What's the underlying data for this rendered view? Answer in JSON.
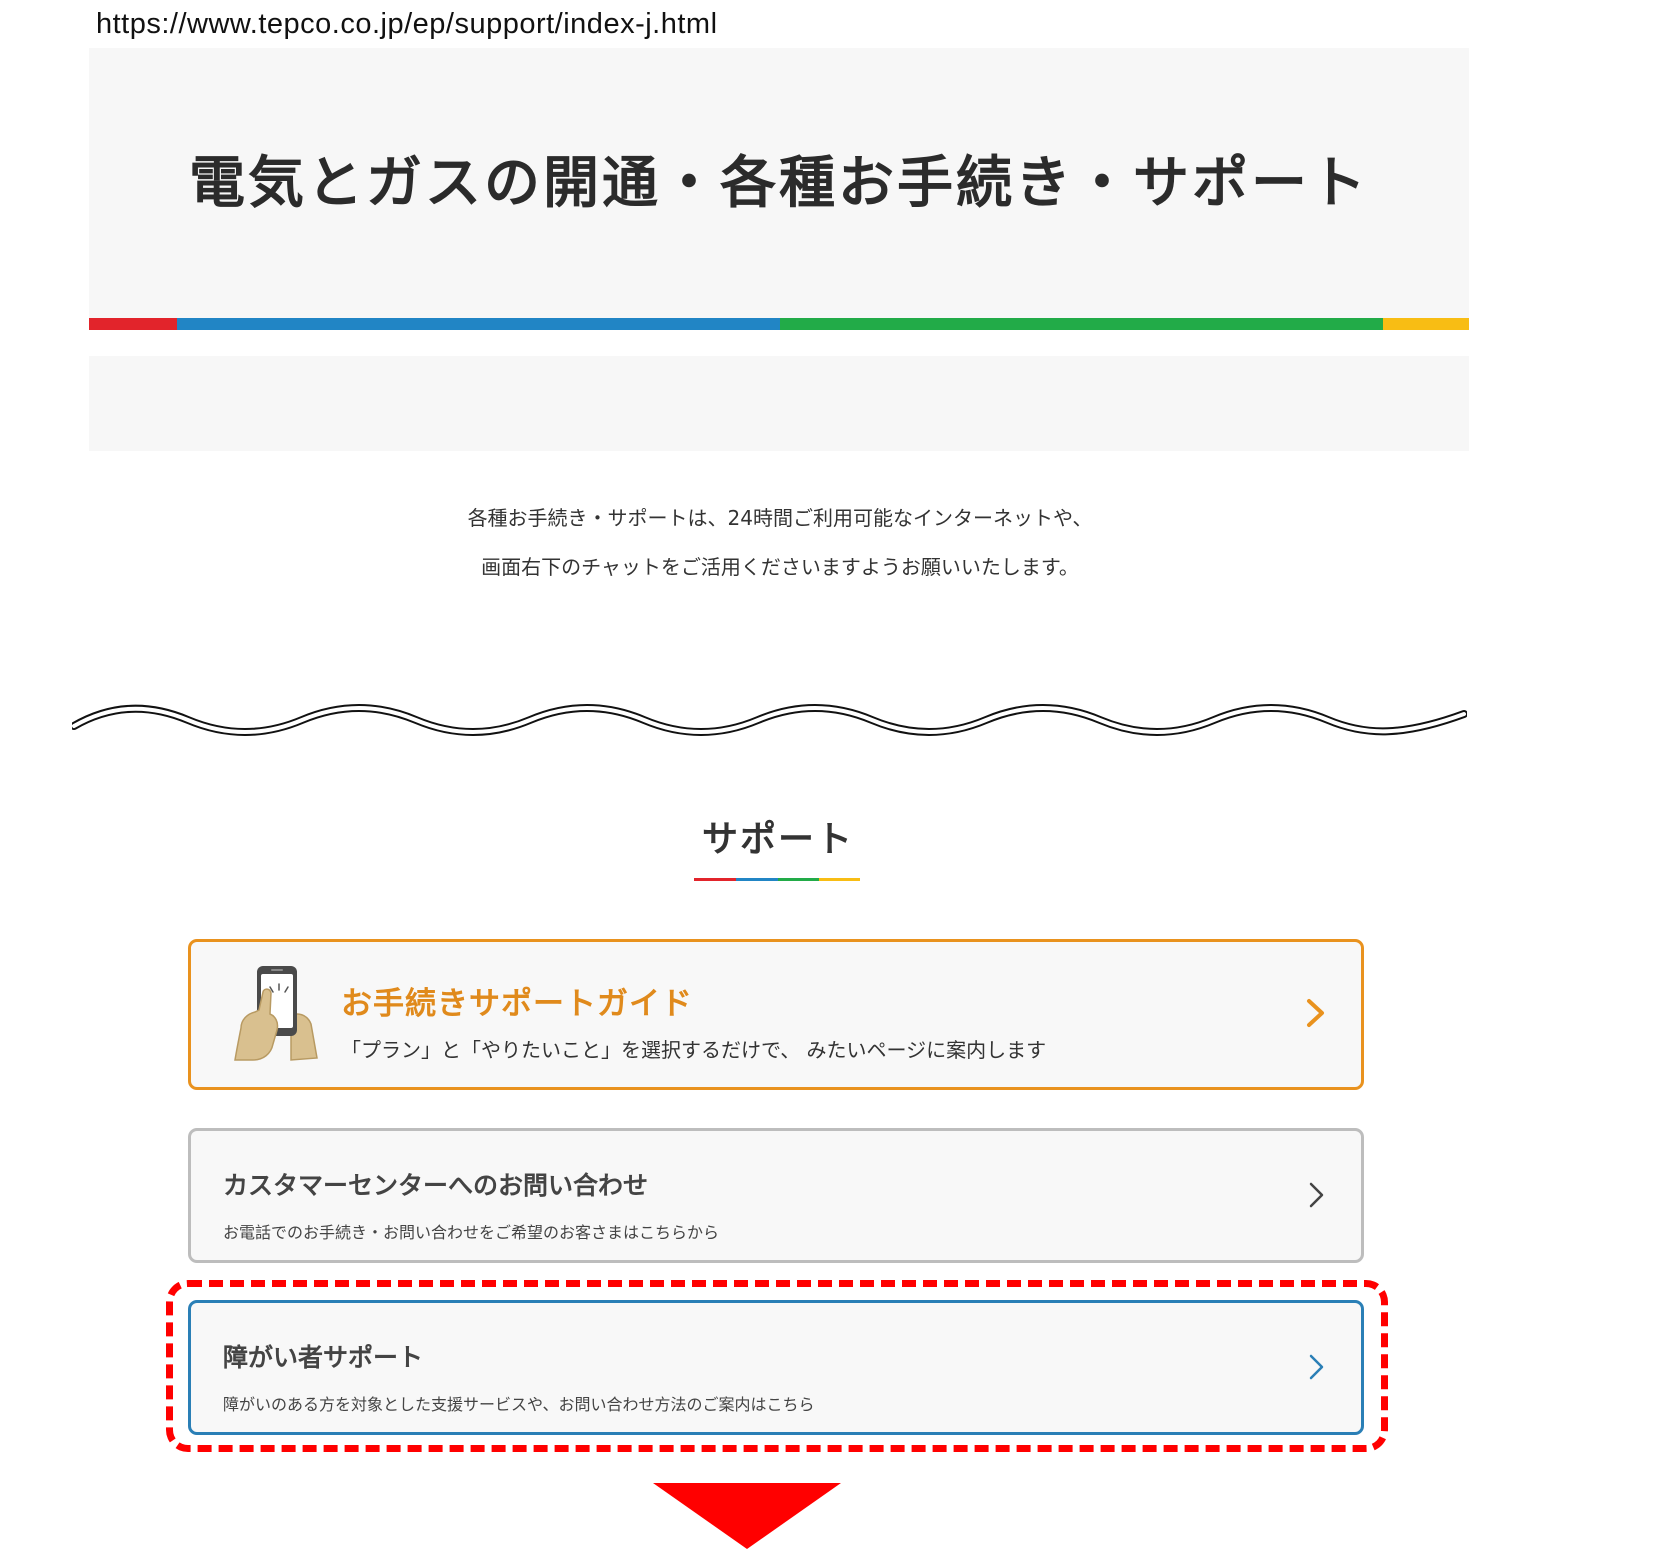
{
  "url_bar": {
    "url": "https://www.tepco.co.jp/ep/support/index-j.html"
  },
  "hero": {
    "title": "電気とガスの開通・各種お手続き・サポート"
  },
  "intro": {
    "line1": "各種お手続き・サポートは、24時間ご利用可能なインターネットや、",
    "line2": "画面右下のチャットをご活用くださいますようお願いいたします。"
  },
  "support_section": {
    "title": "サポート",
    "cards": [
      {
        "title": "お手続きサポートガイド",
        "description": "「プラン」と「やりたいこと」を選択するだけで、 みたいページに案内します",
        "icon": "hand-smartphone-icon",
        "border_color": "#e9921e"
      },
      {
        "title": "カスタマーセンターへのお問い合わせ",
        "description": "お電話でのお手続き・お問い合わせをご希望のお客さまはこちらから",
        "border_color": "#bdbdbd"
      },
      {
        "title": "障がい者サポート",
        "description": "障がいのある方を対象とした支援サービスや、お問い合わせ方法のご案内はこちら",
        "border_color": "#2a7fb6"
      }
    ]
  },
  "colors": {
    "brand_red": "#e2242b",
    "brand_blue": "#2185c5",
    "brand_green": "#22ab48",
    "brand_yellow": "#f8bd14",
    "annotation_red": "#ff0000"
  }
}
